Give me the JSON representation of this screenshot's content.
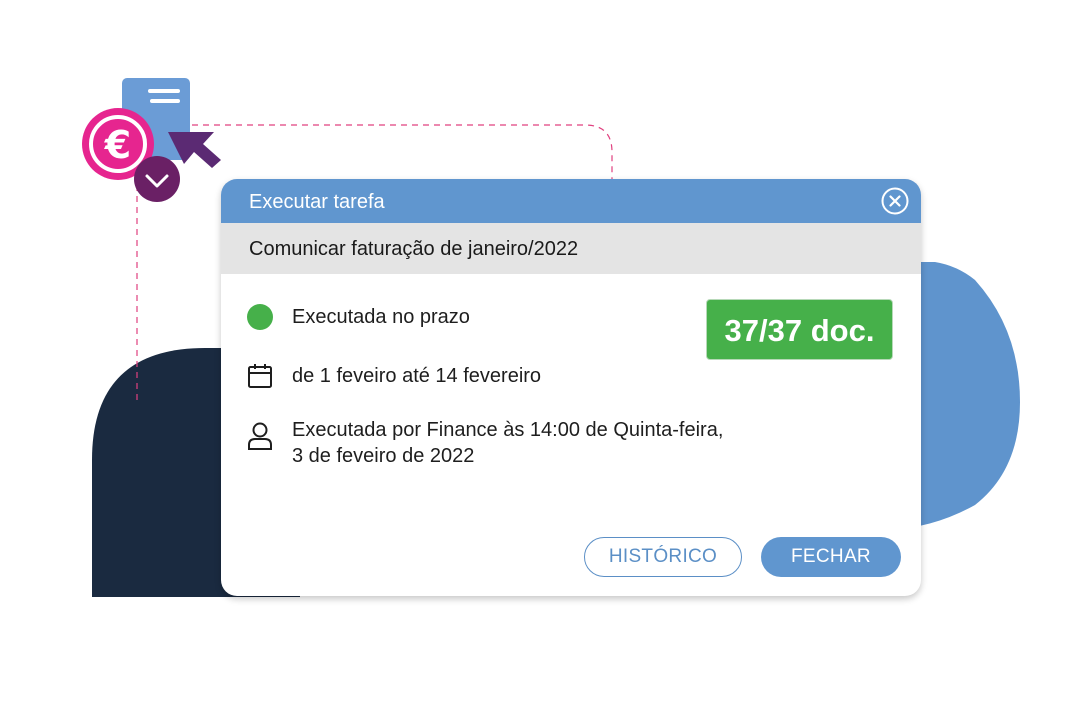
{
  "dialog": {
    "title": "Executar tarefa",
    "subtitle": "Comunicar faturação de janeiro/2022",
    "status_text": "Executada no prazo",
    "status_color": "#46b04a",
    "date_range": "de 1 feveiro até 14 fevereiro",
    "executed_line1": "Executada por Finance às 14:00 de Quinta-feira,",
    "executed_line2": "3 de feveiro de 2022",
    "doc_badge": "37/37 doc.",
    "buttons": {
      "history": "HISTÓRICO",
      "close": "FECHAR"
    },
    "icons": {
      "close": "close-circle-icon",
      "calendar": "calendar-icon",
      "user": "user-icon"
    }
  },
  "colors": {
    "header_blue": "#6096cf",
    "navy": "#1a2a40",
    "accent_pink": "#e6258f",
    "accent_purple": "#6a2065",
    "badge_green": "#46b04a"
  }
}
